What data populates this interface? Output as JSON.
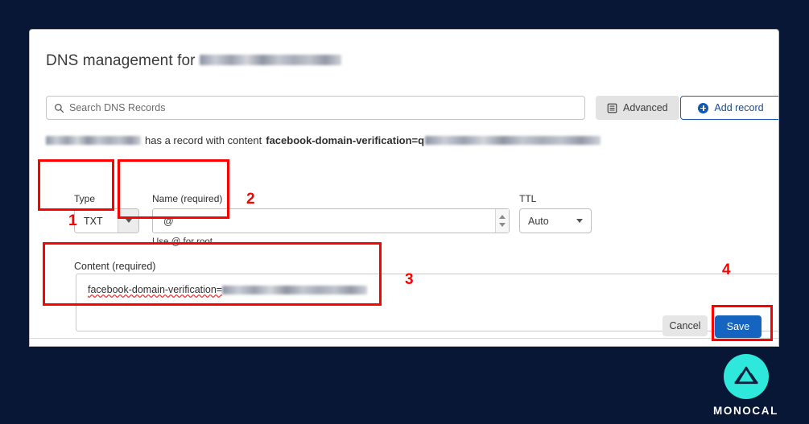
{
  "window": {
    "background_color": "#071735"
  },
  "card": {
    "title_prefix": "DNS management for",
    "title_domain_redacted": true
  },
  "search": {
    "placeholder": "Search DNS Records",
    "icon": "search-icon"
  },
  "toolbar": {
    "advanced_label": "Advanced",
    "advanced_icon": "list-document-icon",
    "add_record_label": "Add record",
    "add_record_icon": "plus-circle-icon",
    "add_record_color": "#0d58b8"
  },
  "notice": {
    "middle_text": "has a record with content",
    "record_content_bold": "facebook-domain-verification=q",
    "domain_redacted": true,
    "value_redacted": true
  },
  "form": {
    "type": {
      "label": "Type",
      "value": "TXT",
      "icon": "chevron-down-icon"
    },
    "name": {
      "label": "Name (required)",
      "value": "@",
      "hint": "Use @ for root",
      "spinner_icons": [
        "chevron-up-icon",
        "chevron-down-icon"
      ]
    },
    "ttl": {
      "label": "TTL",
      "value": "Auto",
      "icon": "chevron-down-icon"
    },
    "content": {
      "label": "Content (required)",
      "value": "facebook-domain-verification=",
      "value_redacted": true
    }
  },
  "footer": {
    "cancel_label": "Cancel",
    "save_label": "Save",
    "save_color": "#1464c0"
  },
  "annotations": {
    "color": "#ff0000",
    "numbers": [
      "1",
      "2",
      "3",
      "4"
    ]
  },
  "branding": {
    "name": "MONOCAL",
    "accent_color": "#2fe8dc",
    "logo_icon": "mountain-logo-icon"
  }
}
